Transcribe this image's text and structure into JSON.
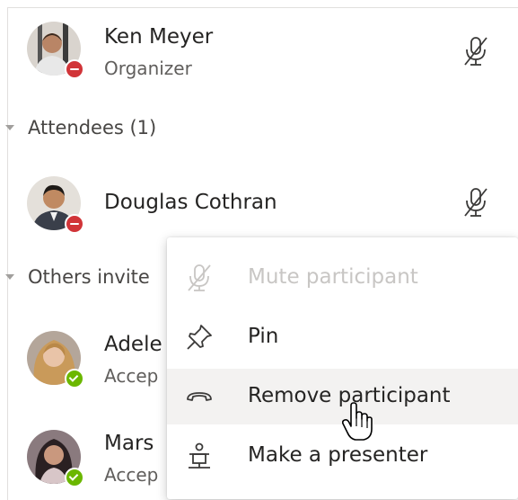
{
  "organizer": {
    "name": "Ken Meyer",
    "role": "Organizer",
    "status": "busy"
  },
  "attendees_section": {
    "label": "Attendees (1)"
  },
  "attendees": [
    {
      "name": "Douglas Cothran",
      "status": "busy"
    }
  ],
  "others_section": {
    "label": "Others invite"
  },
  "others": [
    {
      "name": "Adele",
      "sub": "Accep",
      "status": "accepted"
    },
    {
      "name": "Mars",
      "sub": "Accep",
      "status": "accepted"
    }
  ],
  "context_menu": {
    "items": [
      {
        "label": "Mute participant",
        "icon": "mic-off-icon",
        "disabled": true
      },
      {
        "label": "Pin",
        "icon": "pin-icon",
        "disabled": false
      },
      {
        "label": "Remove participant",
        "icon": "hang-up-icon",
        "disabled": false,
        "hovered": true
      },
      {
        "label": "Make a presenter",
        "icon": "presenter-icon",
        "disabled": false
      }
    ]
  },
  "colors": {
    "busy": "#d13438",
    "available": "#6bb700",
    "menu_hover": "#f3f2f1",
    "disabled_text": "#c8c6c4"
  }
}
